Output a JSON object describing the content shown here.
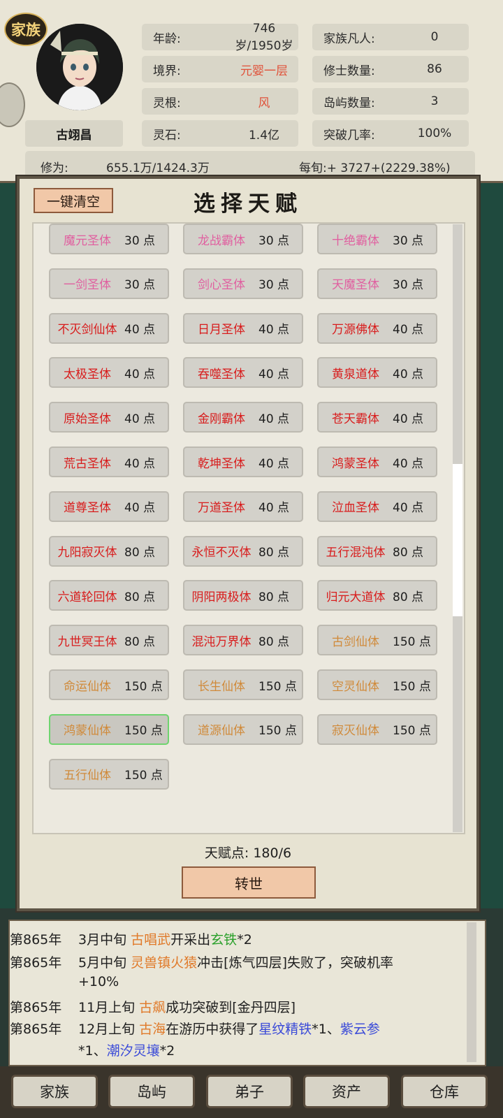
{
  "header": {
    "badge": "家族",
    "name": "古翊昌",
    "stats_left": [
      {
        "label": "年龄:",
        "value": "746岁/1950岁",
        "red": false
      },
      {
        "label": "境界:",
        "value": "元婴一层",
        "red": true
      },
      {
        "label": "灵根:",
        "value": "风",
        "red": true
      },
      {
        "label": "灵石:",
        "value": "1.4亿",
        "red": false
      }
    ],
    "stats_right": [
      {
        "label": "家族凡人:",
        "value": "0"
      },
      {
        "label": "修士数量:",
        "value": "86"
      },
      {
        "label": "岛屿数量:",
        "value": "3"
      },
      {
        "label": "突破几率:",
        "value": "100%"
      }
    ],
    "cultivation_label": "修为:",
    "cultivation_value": "655.1万/1424.3万",
    "per_xun": "每旬:+ 3727+(2229.38%)"
  },
  "dialog": {
    "clear_button": "一键清空",
    "title": "选择天赋",
    "points_text": "天赋点:  180/6",
    "rebirth_button": "转世",
    "colors": {
      "pink": "#e060a0",
      "red": "#d81c1c",
      "orange": "#d08a3a"
    },
    "talents": [
      {
        "name": "魔元圣体",
        "pts": "30 点",
        "color": "pink"
      },
      {
        "name": "龙战霸体",
        "pts": "30 点",
        "color": "pink"
      },
      {
        "name": "十绝霸体",
        "pts": "30 点",
        "color": "pink"
      },
      {
        "name": "一剑圣体",
        "pts": "30 点",
        "color": "pink"
      },
      {
        "name": "剑心圣体",
        "pts": "30 点",
        "color": "pink"
      },
      {
        "name": "天魔圣体",
        "pts": "30 点",
        "color": "pink"
      },
      {
        "name": "不灭剑仙体",
        "pts": "40 点",
        "color": "red"
      },
      {
        "name": "日月圣体",
        "pts": "40 点",
        "color": "red"
      },
      {
        "name": "万源佛体",
        "pts": "40 点",
        "color": "red"
      },
      {
        "name": "太极圣体",
        "pts": "40 点",
        "color": "red"
      },
      {
        "name": "吞噬圣体",
        "pts": "40 点",
        "color": "red"
      },
      {
        "name": "黄泉道体",
        "pts": "40 点",
        "color": "red"
      },
      {
        "name": "原始圣体",
        "pts": "40 点",
        "color": "red"
      },
      {
        "name": "金刚霸体",
        "pts": "40 点",
        "color": "red"
      },
      {
        "name": "苍天霸体",
        "pts": "40 点",
        "color": "red"
      },
      {
        "name": "荒古圣体",
        "pts": "40 点",
        "color": "red"
      },
      {
        "name": "乾坤圣体",
        "pts": "40 点",
        "color": "red"
      },
      {
        "name": "鸿蒙圣体",
        "pts": "40 点",
        "color": "red"
      },
      {
        "name": "道尊圣体",
        "pts": "40 点",
        "color": "red"
      },
      {
        "name": "万道圣体",
        "pts": "40 点",
        "color": "red"
      },
      {
        "name": "泣血圣体",
        "pts": "40 点",
        "color": "red"
      },
      {
        "name": "九阳寂灭体",
        "pts": "80 点",
        "color": "red"
      },
      {
        "name": "永恒不灭体",
        "pts": "80 点",
        "color": "red"
      },
      {
        "name": "五行混沌体",
        "pts": "80 点",
        "color": "red"
      },
      {
        "name": "六道轮回体",
        "pts": "80 点",
        "color": "red"
      },
      {
        "name": "阴阳两极体",
        "pts": "80 点",
        "color": "red"
      },
      {
        "name": "归元大道体",
        "pts": "80 点",
        "color": "red"
      },
      {
        "name": "九世冥王体",
        "pts": "80 点",
        "color": "red"
      },
      {
        "name": "混沌万界体",
        "pts": "80 点",
        "color": "red"
      },
      {
        "name": "古剑仙体",
        "pts": "150 点",
        "color": "orange"
      },
      {
        "name": "命运仙体",
        "pts": "150 点",
        "color": "orange"
      },
      {
        "name": "长生仙体",
        "pts": "150 点",
        "color": "orange"
      },
      {
        "name": "空灵仙体",
        "pts": "150 点",
        "color": "orange"
      },
      {
        "name": "鸿蒙仙体",
        "pts": "150 点",
        "color": "orange",
        "selected": true
      },
      {
        "name": "道源仙体",
        "pts": "150 点",
        "color": "orange"
      },
      {
        "name": "寂灭仙体",
        "pts": "150 点",
        "color": "orange"
      },
      {
        "name": "五行仙体",
        "pts": "150 点",
        "color": "orange"
      }
    ]
  },
  "log": {
    "lines": [
      {
        "year": "第865年",
        "parts": [
          [
            "3月中旬 ",
            ""
          ],
          [
            "古唱武",
            "o"
          ],
          [
            "开采出",
            ""
          ],
          [
            "玄铁",
            "g"
          ],
          [
            "*2",
            ""
          ]
        ]
      },
      {
        "year": "第865年",
        "parts": [
          [
            "5月中旬 ",
            ""
          ],
          [
            "灵兽镇火猿",
            "o"
          ],
          [
            "冲击[炼气四层]失败了，突破机率",
            ""
          ]
        ]
      },
      {
        "year": "",
        "parts": [
          [
            "+10%",
            ""
          ]
        ]
      },
      {
        "year": "第865年",
        "parts": [
          [
            "11月上旬 ",
            ""
          ],
          [
            "古飙",
            "o"
          ],
          [
            "成功突破到[金丹四层]",
            ""
          ]
        ]
      },
      {
        "year": "第865年",
        "parts": [
          [
            "12月上旬 ",
            ""
          ],
          [
            "古海",
            "o"
          ],
          [
            "在游历中获得了",
            ""
          ],
          [
            "星纹精铁",
            "b"
          ],
          [
            "*1、",
            ""
          ],
          [
            "紫云参",
            "b"
          ]
        ]
      },
      {
        "year": "",
        "parts": [
          [
            "*1、",
            ""
          ],
          [
            "潮汐灵壤",
            "b"
          ],
          [
            "*2",
            ""
          ]
        ]
      }
    ]
  },
  "nav": [
    "家族",
    "岛屿",
    "弟子",
    "资产",
    "仓库"
  ]
}
